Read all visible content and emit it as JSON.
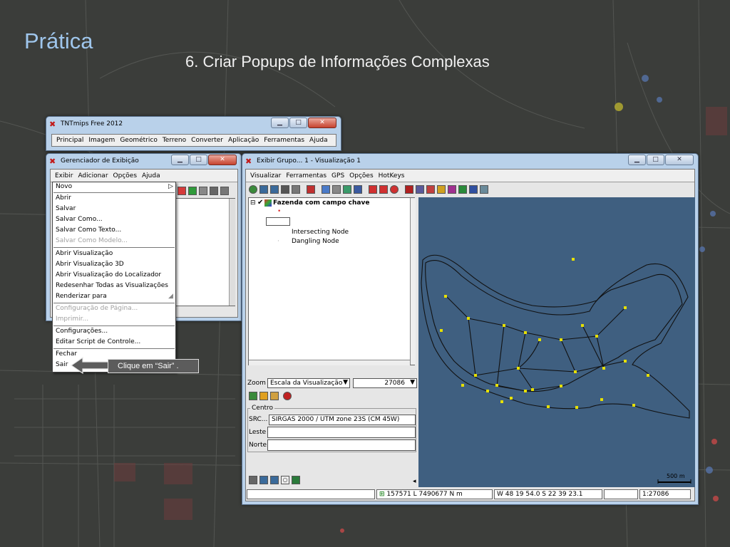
{
  "slide": {
    "title": "Prática",
    "subtitle": "6. Criar Popups de Informações Complexas"
  },
  "tnt": {
    "title": "TNTmips Free 2012",
    "menu": [
      "Principal",
      "Imagem",
      "Geométrico",
      "Terreno",
      "Converter",
      "Aplicação",
      "Ferramentas",
      "Ajuda"
    ]
  },
  "ger": {
    "title": "Gerenciador de Exibição",
    "menu": [
      "Exibir",
      "Adicionar",
      "Opções",
      "Ajuda"
    ]
  },
  "dropdown": {
    "items": [
      {
        "label": "Novo",
        "disabled": false
      },
      {
        "label": "Abrir",
        "disabled": false
      },
      {
        "label": "Salvar",
        "disabled": false
      },
      {
        "label": "Salvar Como...",
        "disabled": false
      },
      {
        "label": "Salvar Como Texto...",
        "disabled": false
      },
      {
        "label": "Salvar Como Modelo...",
        "disabled": true
      },
      {
        "label": "Abrir Visualização",
        "disabled": false
      },
      {
        "label": "Abrir Visualização 3D",
        "disabled": false
      },
      {
        "label": "Abrir Visualização do Localizador",
        "disabled": false
      },
      {
        "label": "Redesenhar Todas as Visualizações",
        "disabled": false
      },
      {
        "label": "Renderizar para",
        "disabled": false
      },
      {
        "label": "Configuração de Página...",
        "disabled": true
      },
      {
        "label": "Imprimir...",
        "disabled": true
      },
      {
        "label": "Configurações...",
        "disabled": false
      },
      {
        "label": "Editar Script de Controle...",
        "disabled": false
      },
      {
        "label": "Fechar",
        "disabled": false
      },
      {
        "label": "Sair",
        "disabled": false
      }
    ]
  },
  "callout": "Clique em “Sair” .",
  "viewer": {
    "title": "Exibir Grupo... 1 - Visualização 1",
    "menu": [
      "Visualizar",
      "Ferramentas",
      "GPS",
      "Opções",
      "HotKeys"
    ],
    "layer": "Fazenda com campo chave",
    "legend": [
      "Intersecting Node",
      "Dangling Node"
    ],
    "zoom_label": "Zoom",
    "zoom_mode": "Escala da Visualização",
    "zoom_value": "27086",
    "centro_label": "Centro",
    "src_label": "SRC...",
    "src_value": "SIRGAS 2000 / UTM zone 23S (CM 45W)",
    "leste_label": "Leste",
    "norte_label": "Norte",
    "scalebar": "500 m",
    "status_xy": "157571 L 7490677 N m",
    "status_ll": "W 48 19 54.0  S 22 39 23.1",
    "status_scale": "1:27086"
  },
  "colors": {
    "map_bg": "#3f5f80",
    "node": "#e6e000",
    "polygon": "#111111"
  }
}
